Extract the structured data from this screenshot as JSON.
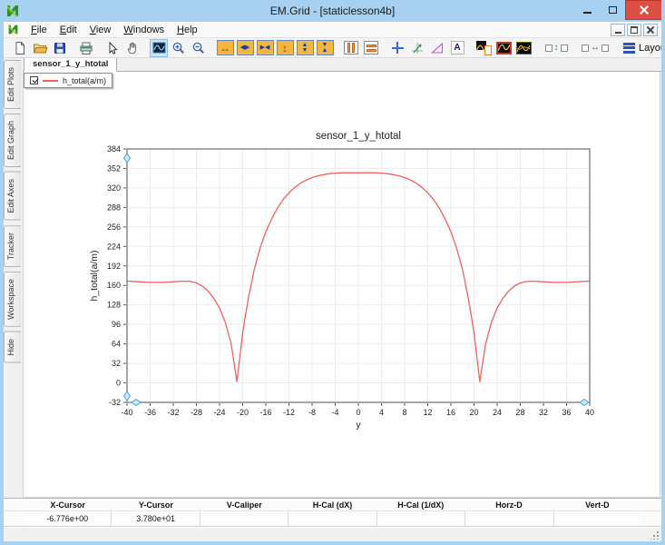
{
  "window": {
    "title": "EM.Grid - [staticlesson4b]"
  },
  "menu": {
    "items": [
      "File",
      "Edit",
      "View",
      "Windows",
      "Help"
    ]
  },
  "toolbar": {
    "layout_label": "Layout"
  },
  "icons": {
    "arrow_h": "↔",
    "arrow_v": "↕",
    "tri_up": "▲",
    "tri_down": "▼",
    "tri_left": "◀",
    "tri_right": "▶",
    "text_tool_glyph": "A"
  },
  "sidebar": {
    "tabs": [
      "Edit Plots",
      "Edit Graph",
      "Edit Axes",
      "Tracker",
      "Workspace",
      "Hide"
    ]
  },
  "tabs": {
    "active": "sensor_1_y_htotal"
  },
  "legend": {
    "checked": true,
    "label": "h_total(a/m)",
    "line_color": "#f15f5f"
  },
  "chart_data": {
    "type": "line",
    "title": "sensor_1_y_htotal",
    "xlabel": "y",
    "ylabel": "h_total(a/m)",
    "xlim": [
      -40,
      40
    ],
    "ylim": [
      -32,
      384
    ],
    "xticks": [
      -40,
      -36,
      -32,
      -28,
      -24,
      -20,
      -16,
      -12,
      -8,
      -4,
      0,
      4,
      8,
      12,
      16,
      20,
      24,
      28,
      32,
      36,
      40
    ],
    "yticks": [
      -32,
      0,
      32,
      64,
      96,
      128,
      160,
      192,
      224,
      256,
      288,
      320,
      352,
      384
    ],
    "grid": true,
    "frame_color": "#8f8f8f",
    "grid_color": "#ececec",
    "handle_stroke": "#48a2de",
    "handle_fill": "#cce9fb",
    "series": [
      {
        "name": "h_total(a/m)",
        "color": "#f15f5f",
        "points": [
          [
            -40,
            167
          ],
          [
            -38,
            166
          ],
          [
            -36,
            165
          ],
          [
            -34,
            165
          ],
          [
            -32,
            166
          ],
          [
            -30,
            167
          ],
          [
            -29,
            166.5
          ],
          [
            -28,
            164
          ],
          [
            -27,
            159
          ],
          [
            -26,
            151
          ],
          [
            -25,
            139
          ],
          [
            -24,
            123
          ],
          [
            -23,
            99
          ],
          [
            -22,
            64
          ],
          [
            -21.5,
            34
          ],
          [
            -21,
            2
          ],
          [
            -20.5,
            42
          ],
          [
            -20,
            82
          ],
          [
            -19.5,
            112
          ],
          [
            -19,
            140
          ],
          [
            -18,
            186
          ],
          [
            -17,
            221
          ],
          [
            -16,
            248
          ],
          [
            -15,
            269
          ],
          [
            -14,
            287
          ],
          [
            -13,
            301
          ],
          [
            -12,
            312
          ],
          [
            -11,
            321
          ],
          [
            -10,
            328
          ],
          [
            -9,
            333
          ],
          [
            -8,
            337
          ],
          [
            -7,
            340
          ],
          [
            -6,
            342
          ],
          [
            -5,
            343.5
          ],
          [
            -4,
            344.3
          ],
          [
            -3,
            344.8
          ],
          [
            -2,
            345
          ],
          [
            -1,
            345
          ],
          [
            0,
            345
          ],
          [
            1,
            345
          ],
          [
            2,
            345
          ],
          [
            3,
            344.8
          ],
          [
            4,
            344.3
          ],
          [
            5,
            343.5
          ],
          [
            6,
            342
          ],
          [
            7,
            340
          ],
          [
            8,
            337
          ],
          [
            9,
            333
          ],
          [
            10,
            328
          ],
          [
            11,
            321
          ],
          [
            12,
            312
          ],
          [
            13,
            301
          ],
          [
            14,
            287
          ],
          [
            15,
            269
          ],
          [
            16,
            248
          ],
          [
            17,
            221
          ],
          [
            18,
            186
          ],
          [
            19,
            140
          ],
          [
            19.5,
            112
          ],
          [
            20,
            82
          ],
          [
            20.5,
            42
          ],
          [
            21,
            2
          ],
          [
            21.5,
            34
          ],
          [
            22,
            64
          ],
          [
            23,
            99
          ],
          [
            24,
            123
          ],
          [
            25,
            139
          ],
          [
            26,
            151
          ],
          [
            27,
            159
          ],
          [
            28,
            164
          ],
          [
            29,
            166.5
          ],
          [
            30,
            167
          ],
          [
            32,
            166
          ],
          [
            34,
            165
          ],
          [
            36,
            165
          ],
          [
            38,
            166
          ],
          [
            40,
            167
          ]
        ]
      }
    ]
  },
  "status_table": {
    "columns": [
      "X-Cursor",
      "Y-Cursor",
      "V-Caliper",
      "H-Cal (dX)",
      "H-Cal (1/dX)",
      "Horz-D",
      "Vert-D"
    ],
    "values": [
      "-6.776e+00",
      "3.780e+01",
      "",
      "",
      "",
      "",
      ""
    ]
  },
  "colors": {
    "titlebar": "#a6d1f0",
    "close_button": "#dd4f43",
    "window_border": "#a6d1f0",
    "curve": "#f15f5f",
    "toolbar_yellow": "#f2b83d",
    "active_tool_bg": "#cde6f7"
  }
}
